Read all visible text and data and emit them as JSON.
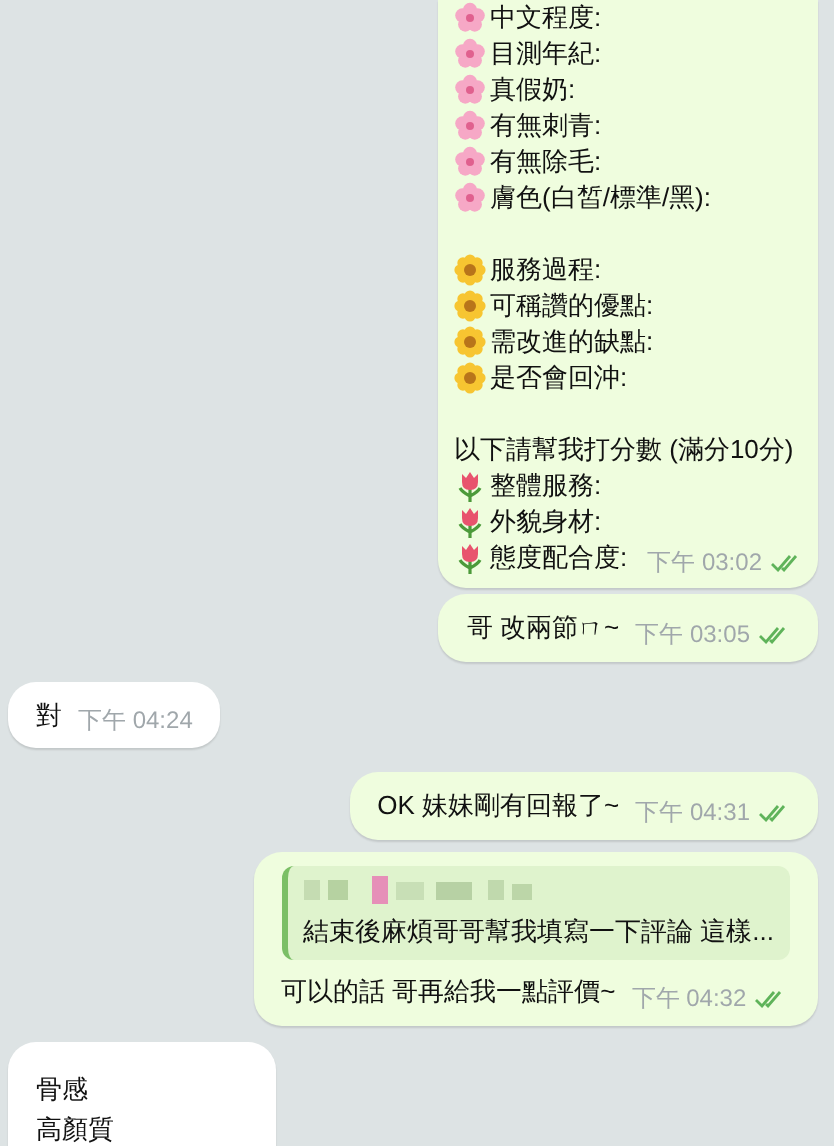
{
  "messages": [
    {
      "kind": "outgoing",
      "sections": [
        [
          {
            "kind": "blossom",
            "text": "中文程度:"
          },
          {
            "kind": "blossom",
            "text": "目測年紀:"
          },
          {
            "kind": "blossom",
            "text": "真假奶:"
          },
          {
            "kind": "blossom",
            "text": "有無刺青:"
          },
          {
            "kind": "blossom",
            "text": "有無除毛:"
          },
          {
            "kind": "blossom",
            "text": "膚色(白皙/標準/黑):"
          }
        ],
        [
          {
            "kind": "sunflower",
            "text": "服務過程:"
          },
          {
            "kind": "sunflower",
            "text": "可稱讚的優點:"
          },
          {
            "kind": "sunflower",
            "text": "需改進的缺點:"
          },
          {
            "kind": "sunflower",
            "text": "是否會回沖:"
          }
        ],
        [
          {
            "kind": "text",
            "text": "以下請幫我打分數 (滿分10分)"
          },
          {
            "kind": "tulip",
            "text": "整體服務:"
          },
          {
            "kind": "tulip",
            "text": "外貌身材:"
          },
          {
            "kind": "tulip",
            "text": "態度配合度:"
          }
        ]
      ],
      "time": "下午 03:02",
      "read": true
    },
    {
      "kind": "outgoing",
      "text": "哥 改兩節ㄇ~",
      "time": "下午 03:05",
      "read": true
    },
    {
      "kind": "incoming",
      "text": "對",
      "time": "下午 04:24"
    },
    {
      "kind": "outgoing",
      "text": "OK 妹妹剛有回報了~",
      "time": "下午 04:31",
      "read": true
    },
    {
      "kind": "outgoing",
      "quote": "結束後麻煩哥哥幫我填寫一下評論 這樣...",
      "text": "可以的話 哥再給我一點評價~",
      "time": "下午 04:32",
      "read": true
    },
    {
      "kind": "incoming",
      "lines": [
        "骨感",
        "高顏質"
      ]
    }
  ]
}
